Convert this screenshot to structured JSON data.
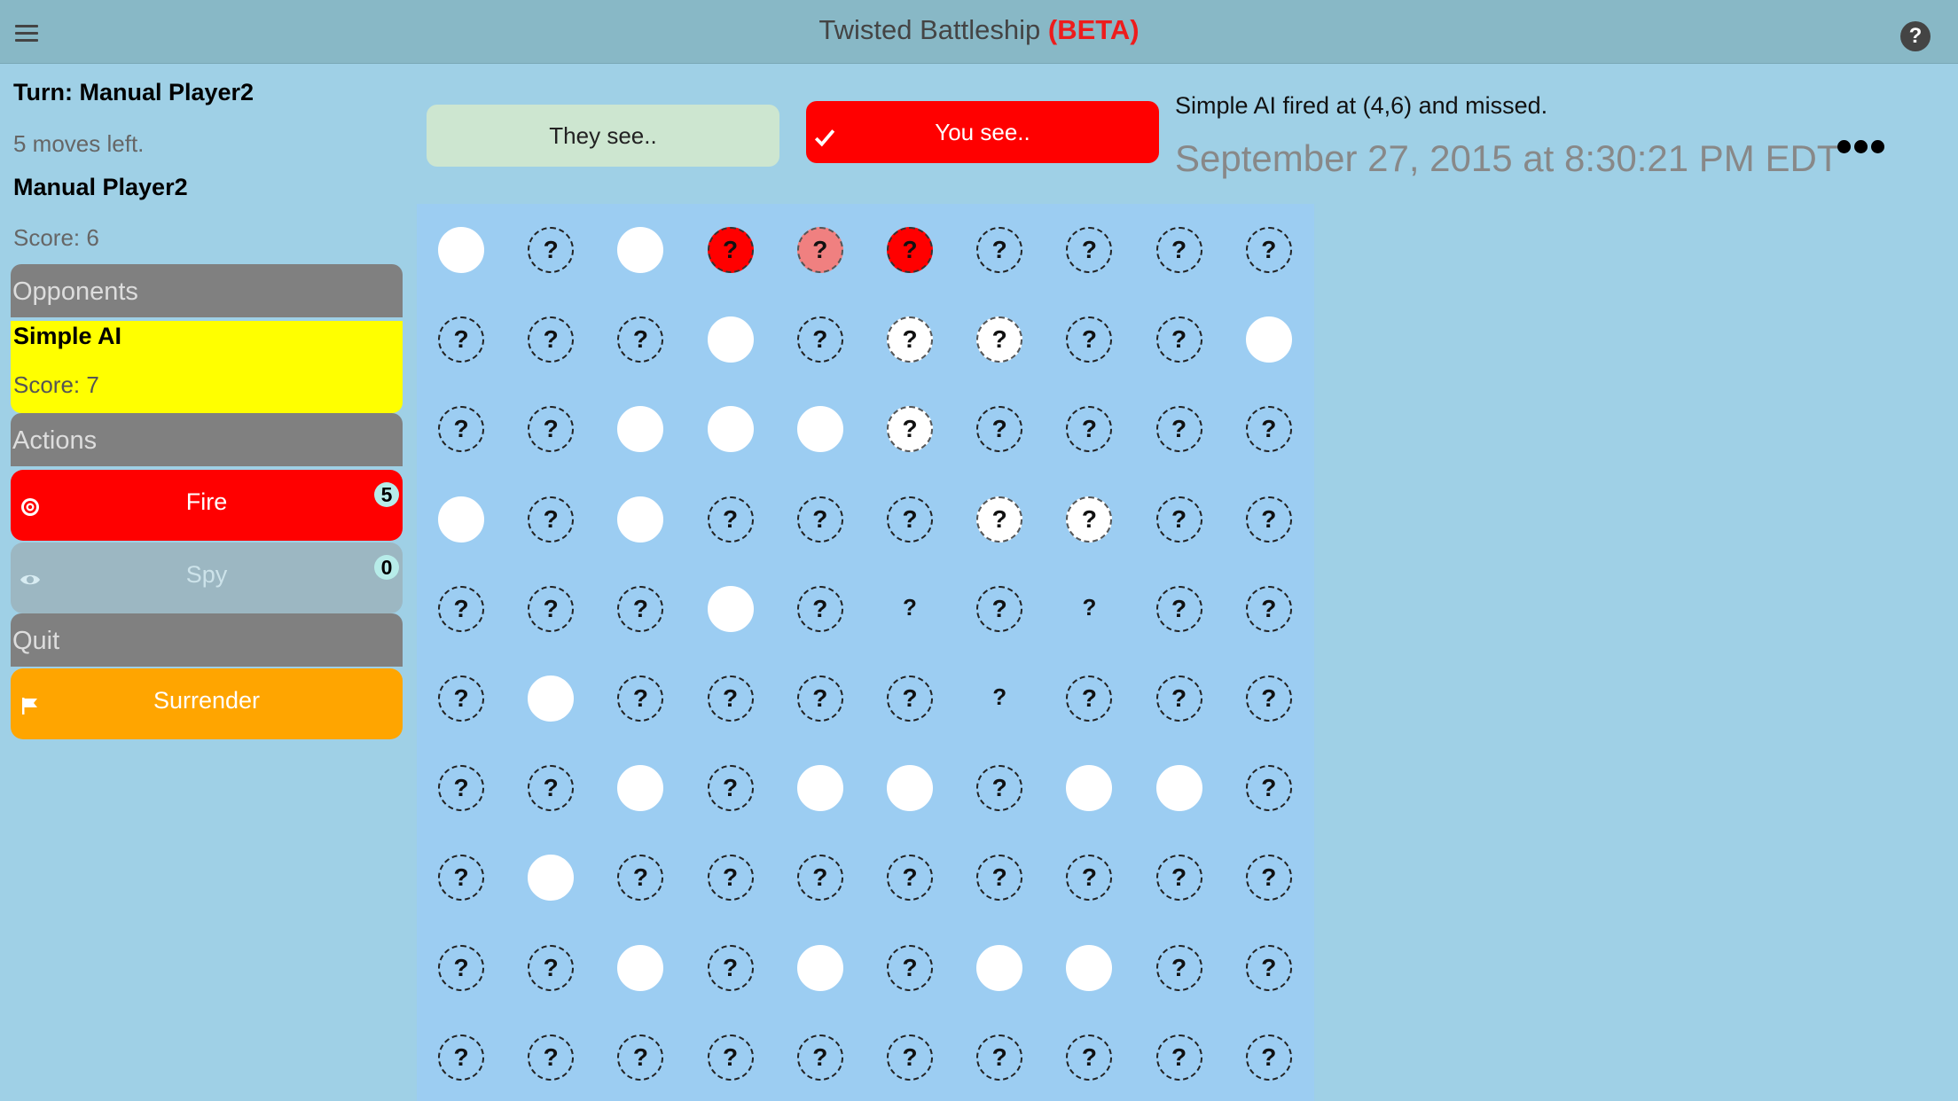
{
  "header": {
    "title": "Twisted Battleship",
    "badge": "(BETA)"
  },
  "sidebar": {
    "turn": "Turn: Manual Player2",
    "moves_left": "5 moves left.",
    "player_name": "Manual Player2",
    "player_score": "Score: 6",
    "opponents_heading": "Opponents",
    "opponent": {
      "name": "Simple AI",
      "score": "Score: 7"
    },
    "actions_heading": "Actions",
    "actions": [
      {
        "label": "Fire",
        "count": "5",
        "icon": "target-icon"
      },
      {
        "label": "Spy",
        "count": "0",
        "icon": "eye-icon"
      }
    ],
    "quit_heading": "Quit",
    "surrender": {
      "label": "Surrender",
      "icon": "flag-icon"
    }
  },
  "view_toggle": {
    "they_see": "They see..",
    "you_see": "You see..",
    "selected": "you_see"
  },
  "status": {
    "message": "Simple AI fired at (4,6) and missed.",
    "timestamp": "September 27, 2015 at 8:30:21 PM EDT"
  },
  "board": {
    "cell_symbol": "?",
    "legend_states": [
      "unknown",
      "miss",
      "spied",
      "hit",
      "hit-light",
      "sunk"
    ],
    "rows": [
      [
        "miss",
        "unknown",
        "miss",
        "hit",
        "hit-light",
        "hit",
        "unknown",
        "unknown",
        "unknown",
        "unknown"
      ],
      [
        "unknown",
        "unknown",
        "unknown",
        "miss",
        "unknown",
        "spied",
        "spied",
        "unknown",
        "unknown",
        "miss"
      ],
      [
        "unknown",
        "unknown",
        "miss",
        "miss",
        "miss",
        "spied",
        "unknown",
        "unknown",
        "unknown",
        "unknown"
      ],
      [
        "miss",
        "unknown",
        "miss",
        "unknown",
        "unknown",
        "unknown",
        "spied",
        "spied",
        "unknown",
        "unknown"
      ],
      [
        "unknown",
        "unknown",
        "unknown",
        "miss",
        "unknown",
        "sunk",
        "unknown",
        "sunk",
        "unknown",
        "unknown"
      ],
      [
        "unknown",
        "miss",
        "unknown",
        "unknown",
        "unknown",
        "unknown",
        "sunk",
        "unknown",
        "unknown",
        "unknown"
      ],
      [
        "unknown",
        "unknown",
        "miss",
        "unknown",
        "miss",
        "miss",
        "unknown",
        "miss",
        "miss",
        "unknown"
      ],
      [
        "unknown",
        "miss",
        "unknown",
        "unknown",
        "unknown",
        "unknown",
        "unknown",
        "unknown",
        "unknown",
        "unknown"
      ],
      [
        "unknown",
        "unknown",
        "miss",
        "unknown",
        "miss",
        "unknown",
        "miss",
        "miss",
        "unknown",
        "unknown"
      ],
      [
        "unknown",
        "unknown",
        "unknown",
        "unknown",
        "unknown",
        "unknown",
        "unknown",
        "unknown",
        "unknown",
        "unknown"
      ]
    ]
  }
}
